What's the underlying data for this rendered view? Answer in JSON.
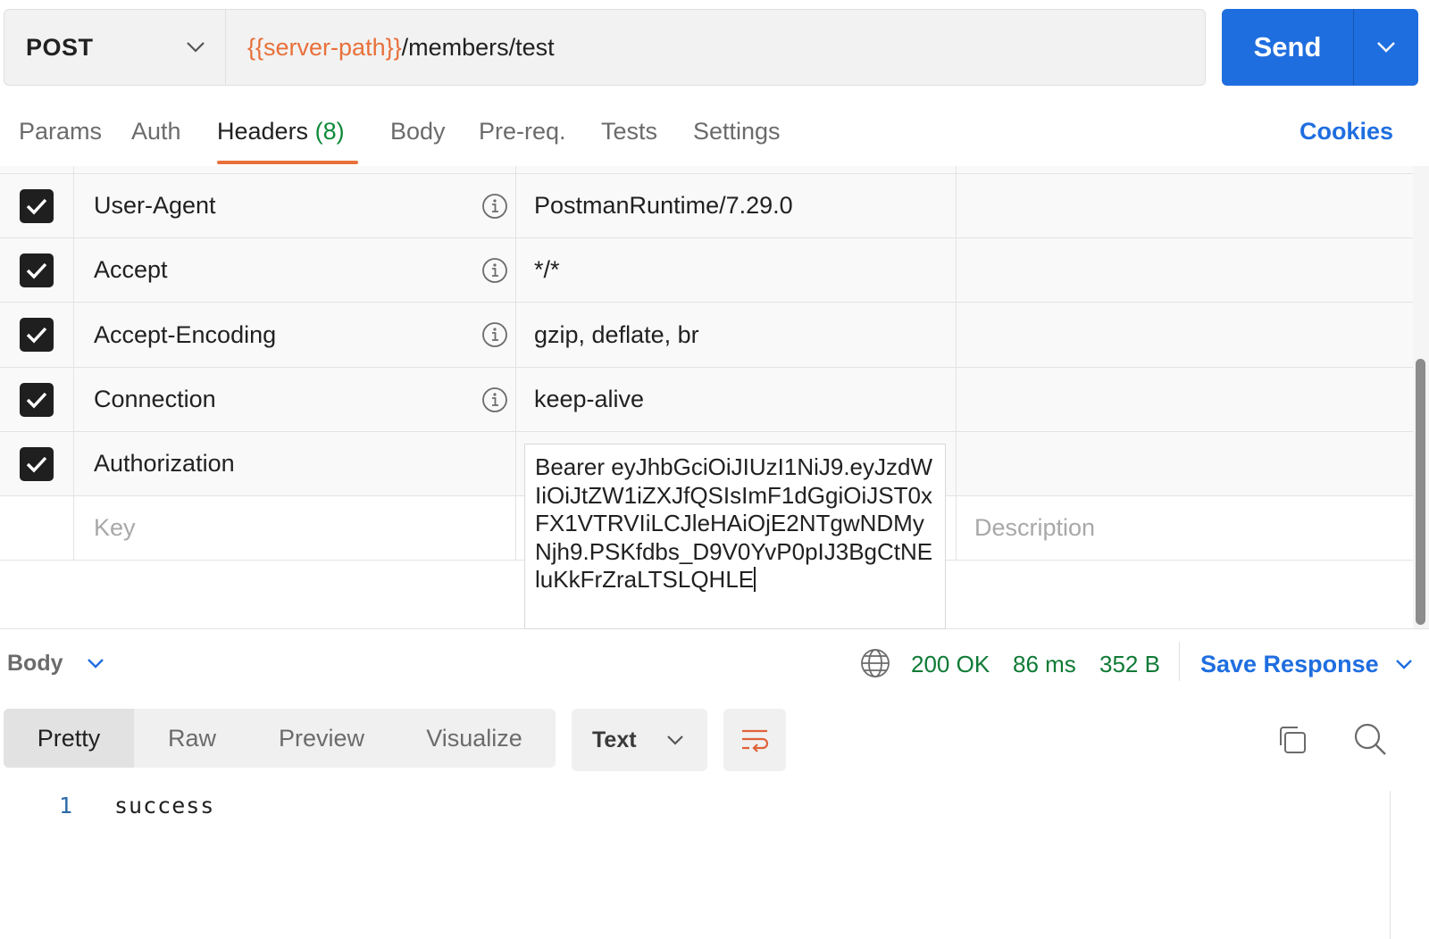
{
  "request": {
    "method": "POST",
    "url_variable": "{{server-path}}",
    "url_path": "/members/test",
    "send_label": "Send"
  },
  "tabs": {
    "params": "Params",
    "auth": "Auth",
    "headers": "Headers",
    "headers_count": "(8)",
    "body": "Body",
    "prereq": "Pre-req.",
    "tests": "Tests",
    "settings": "Settings",
    "cookies": "Cookies"
  },
  "headers": [
    {
      "key": "User-Agent",
      "value": "PostmanRuntime/7.29.0",
      "checked": true
    },
    {
      "key": "Accept",
      "value": "*/*",
      "checked": true
    },
    {
      "key": "Accept-Encoding",
      "value": "gzip, deflate, br",
      "checked": true
    },
    {
      "key": "Connection",
      "value": "keep-alive",
      "checked": true
    },
    {
      "key": "Authorization",
      "value": "Bearer eyJhbGciOiJIUzI1NiJ9.eyJzdWIiOiJtZW1iZXJfQSIsImF1dGgiOiJST0xFX1VTRVIiLCJleHAiOjE2NTgwNDMyNjh9.PSKfdbs_D9V0YvP0pIJ3BgCtNEluKkFrZraLTSLQHLE",
      "checked": true
    }
  ],
  "new_row": {
    "key_placeholder": "Key",
    "description_placeholder": "Description"
  },
  "response": {
    "body_label": "Body",
    "status": "200 OK",
    "time": "86 ms",
    "size": "352 B",
    "save_label": "Save Response",
    "views": [
      "Pretty",
      "Raw",
      "Preview",
      "Visualize"
    ],
    "format": "Text",
    "line_number": "1",
    "content": "success"
  },
  "colors": {
    "accent_blue": "#1f6ee0",
    "orange": "#e8703a",
    "status_green": "#0f7a35"
  }
}
